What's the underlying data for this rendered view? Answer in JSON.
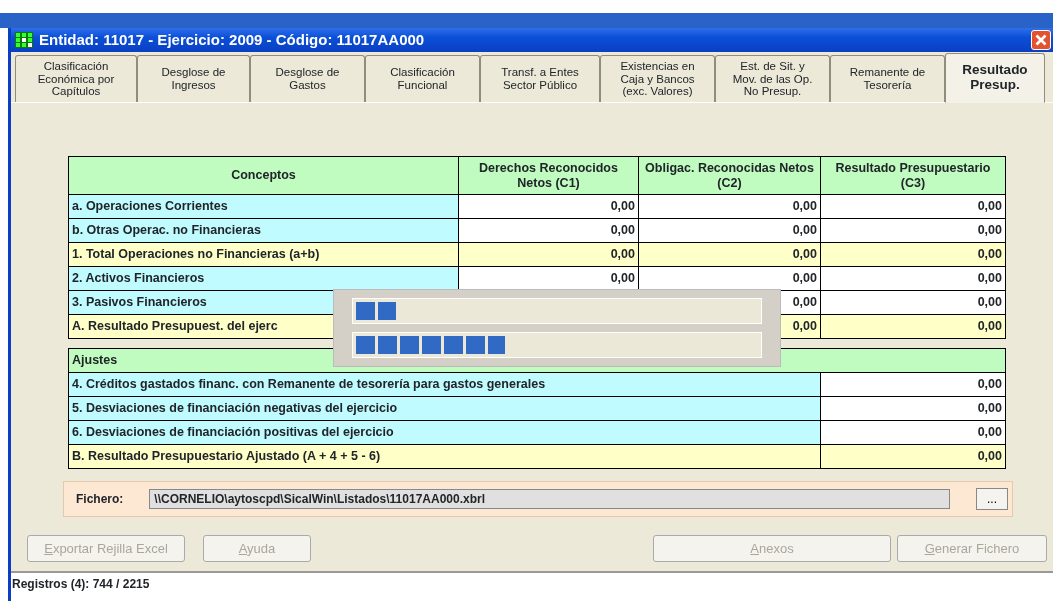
{
  "window": {
    "title": "Entidad: 11017 - Ejercicio: 2009 - Código: 11017AA000"
  },
  "tabs": [
    {
      "lines": [
        "Clasificación",
        "Económica por",
        "Capítulos"
      ],
      "selected": false
    },
    {
      "lines": [
        "Desglose de",
        "Ingresos"
      ],
      "selected": false
    },
    {
      "lines": [
        "Desglose de",
        "Gastos"
      ],
      "selected": false
    },
    {
      "lines": [
        "Clasificación",
        "Funcional"
      ],
      "selected": false
    },
    {
      "lines": [
        "Transf. a Entes",
        "Sector Público"
      ],
      "selected": false
    },
    {
      "lines": [
        "Existencias en",
        "Caja y Bancos",
        "(exc. Valores)"
      ],
      "selected": false
    },
    {
      "lines": [
        "Est. de Sit. y",
        "Mov. de las Op.",
        "No Presup."
      ],
      "selected": false
    },
    {
      "lines": [
        "Remanente de",
        "Tesorería"
      ],
      "selected": false
    },
    {
      "lines": [
        "Resultado",
        "Presup."
      ],
      "selected": true
    }
  ],
  "table": {
    "columns": [
      "Conceptos",
      "Derechos Reconocidos Netos (C1)",
      "Obligac. Reconocidas Netos (C2)",
      "Resultado Presupuestario (C3)"
    ],
    "rows": [
      {
        "kind": "line",
        "label": "a. Operaciones Corrientes",
        "c1": "0,00",
        "c2": "0,00",
        "c3": "0,00"
      },
      {
        "kind": "line",
        "label": "b. Otras Operac. no Financieras",
        "c1": "0,00",
        "c2": "0,00",
        "c3": "0,00"
      },
      {
        "kind": "total",
        "label": "1. Total Operaciones no Financieras (a+b)",
        "c1": "0,00",
        "c2": "0,00",
        "c3": "0,00"
      },
      {
        "kind": "line",
        "label": "2. Activos Financieros",
        "c1": "0,00",
        "c2": "0,00",
        "c3": "0,00"
      },
      {
        "kind": "line",
        "label": "3. Pasivos Financieros",
        "c2": "0,00",
        "c3": "0,00"
      },
      {
        "kind": "total",
        "label": "A. Resultado Presupuest. del ejerc",
        "c2": "0,00",
        "c3": "0,00"
      }
    ]
  },
  "adjustments": {
    "heading": "Ajustes",
    "rows": [
      {
        "kind": "line",
        "label": "4. Créditos gastados financ. con Remanente de tesorería para gastos generales",
        "value": "0,00"
      },
      {
        "kind": "line",
        "label": "5. Desviaciones de financiación negativas del ejercicio",
        "value": "0,00"
      },
      {
        "kind": "line",
        "label": "6. Desviaciones de financiación positivas del ejercicio",
        "value": "0,00"
      },
      {
        "kind": "total",
        "label": "B. Resultado Presupuestario Ajustado (A + 4 + 5 - 6)",
        "value": "0,00"
      }
    ]
  },
  "progress": [
    {
      "level": 0.1
    },
    {
      "level": 0.37
    }
  ],
  "file": {
    "label": "Fichero:",
    "value": "\\\\CORNELIO\\aytoscpd\\SicalWin\\Listados\\11017AA000.xbrl",
    "browse": "..."
  },
  "buttons_left": [
    {
      "label": "Exportar Rejilla Excel",
      "disabled": true
    },
    {
      "label": "Ayuda",
      "disabled": true
    }
  ],
  "buttons_right": [
    {
      "label": "Anexos",
      "disabled": true
    },
    {
      "label": "Generar Fichero",
      "disabled": true
    }
  ],
  "status_bar": "Registros (4): 744 / 2215"
}
